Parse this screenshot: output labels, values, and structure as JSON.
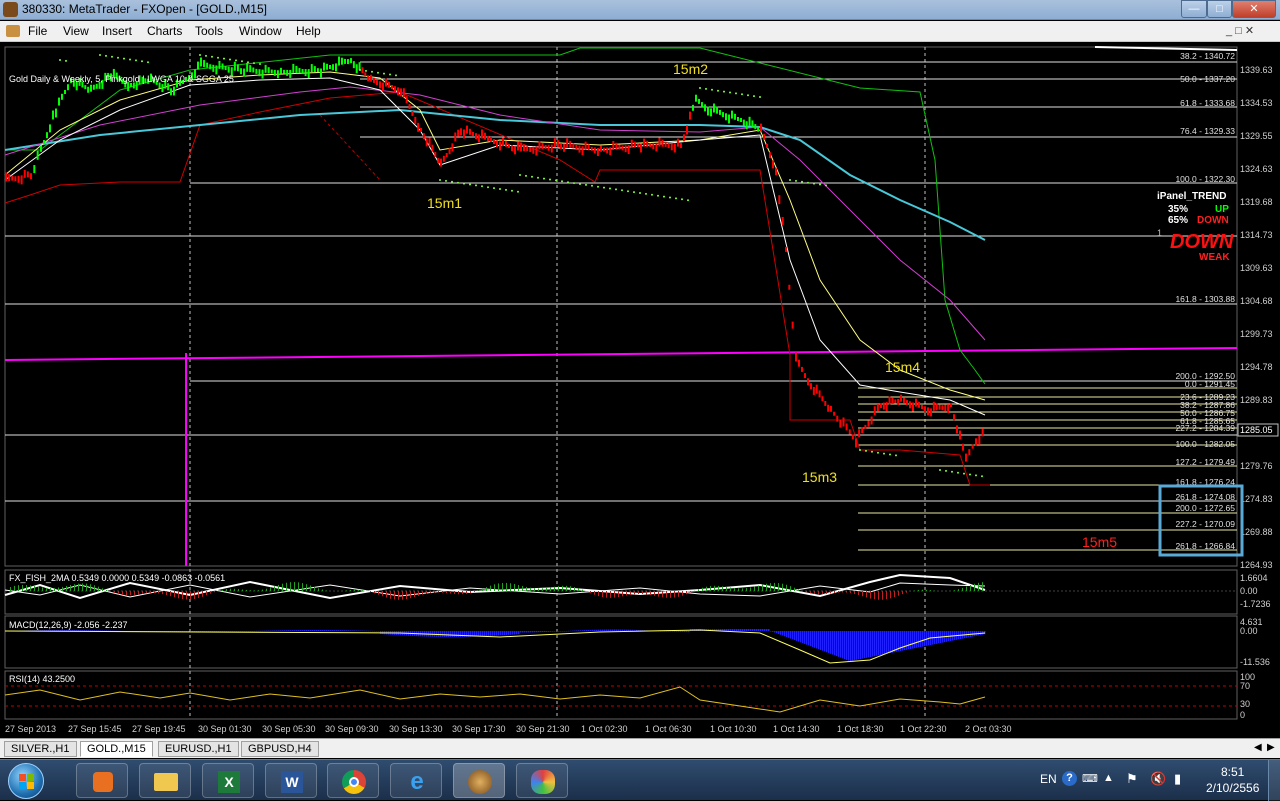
{
  "window": {
    "title": "380330: MetaTrader - FXOpen - [GOLD.,M15]"
  },
  "menu": [
    "File",
    "View",
    "Insert",
    "Charts",
    "Tools",
    "Window",
    "Help"
  ],
  "chart": {
    "header": "Gold Daily & Weekly, 5, Pinkgold | LWGA 10 & SGGA 25",
    "current_price": "1285.05",
    "price_ticks": [
      "1339.63",
      "1334.53",
      "1329.55",
      "1324.63",
      "1319.68",
      "1314.73",
      "1309.63",
      "1304.68",
      "1299.73",
      "1294.78",
      "1289.83",
      "1279.76",
      "1274.83",
      "1269.88",
      "1264.93"
    ],
    "fib_labels": [
      "38.2 - 1340.72",
      "50.0 - 1337.20",
      "61.8 - 1333.68",
      "76.4 - 1329.33",
      "100.0 - 1322.30",
      "161.8 - 1303.88",
      "200.0 - 1292.50",
      "0.0 - 1291.45",
      "23.6 - 1289.23",
      "38.2 - 1287.86",
      "50.0 - 1286.75",
      "61.8 - 1285.65",
      "227.2 - 1284.39",
      "100.0 - 1282.05",
      "127.2 - 1279.49",
      "161.8 - 1276.24",
      "261.8 - 1274.08",
      "200.0 - 1272.65",
      "227.2 - 1270.09",
      "261.8 - 1266.84"
    ],
    "wave_labels": [
      "15m1",
      "15m2",
      "15m3",
      "15m4",
      "15m5"
    ],
    "ipanel": {
      "title": "iPanel_TREND",
      "up_pct": "35%",
      "up_label": "UP",
      "down_pct": "65%",
      "down_label": "DOWN",
      "big": "DOWN",
      "strength": "WEAK",
      "partial": "1"
    },
    "fisher": {
      "label": "FX_FISH_2MA 0.5349 0.0000 0.5349 -0.0863 -0.0561",
      "ticks": [
        "1.6604",
        "0.00",
        "-1.7236"
      ]
    },
    "macd": {
      "label": "MACD(12,26,9) -2.056 -2.237",
      "ticks": [
        "4.631",
        "0.00",
        "-11.536"
      ]
    },
    "rsi": {
      "label": "RSI(14) 43.2500",
      "ticks": [
        "100",
        "70",
        "30",
        "0"
      ]
    },
    "time_ticks": [
      "27 Sep 2013",
      "27 Sep 15:45",
      "27 Sep 19:45",
      "30 Sep 01:30",
      "30 Sep 05:30",
      "30 Sep 09:30",
      "30 Sep 13:30",
      "30 Sep 17:30",
      "30 Sep 21:30",
      "1 Oct 02:30",
      "1 Oct 06:30",
      "1 Oct 10:30",
      "1 Oct 14:30",
      "1 Oct 18:30",
      "1 Oct 22:30",
      "2 Oct 03:30"
    ],
    "colors": {
      "bull": "#00ff00",
      "bear": "#ff0000",
      "magenta": "#ff00ff",
      "cyan": "#48c8d8",
      "wave_label": "#f0e020"
    }
  },
  "tabs": [
    "SILVER.,H1",
    "GOLD.,M15",
    "EURUSD.,H1",
    "GBPUSD,H4"
  ],
  "active_tab": "GOLD.,M15",
  "taskbar": {
    "apps": [
      "media-player-icon",
      "folder-icon",
      "excel-icon",
      "word-icon",
      "chrome-icon",
      "ie-icon",
      "metatrader-icon",
      "paint-icon"
    ],
    "lang": "EN",
    "time": "8:51",
    "date": "2/10/2556"
  }
}
